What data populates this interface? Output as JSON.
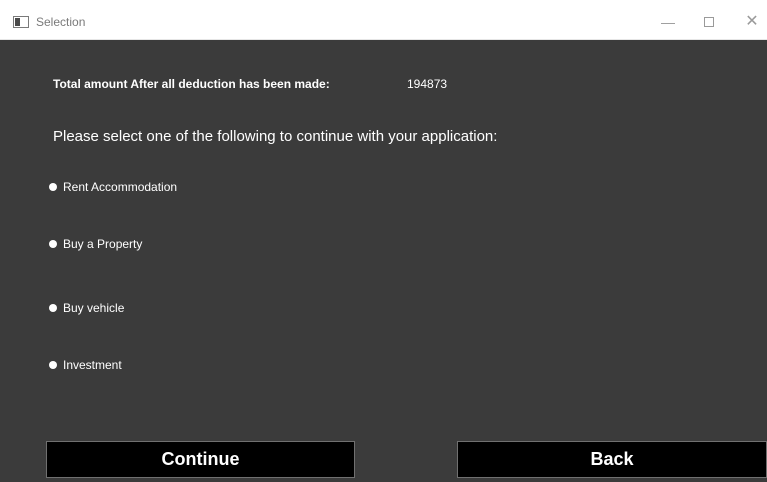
{
  "window": {
    "title": "Selection",
    "controls": {
      "minimize": "—",
      "close": "✕"
    }
  },
  "summary": {
    "label": "Total amount After all deduction has been made:",
    "value": "194873"
  },
  "prompt": "Please select one of the following to continue with your application:",
  "options": [
    {
      "label": "Rent Accommodation"
    },
    {
      "label": "Buy a Property"
    },
    {
      "label": "Buy vehicle"
    },
    {
      "label": "Investment"
    }
  ],
  "buttons": {
    "continue": "Continue",
    "back": "Back"
  },
  "colors": {
    "background": "#3b3b3b",
    "button": "#000000",
    "text": "#ffffff"
  }
}
